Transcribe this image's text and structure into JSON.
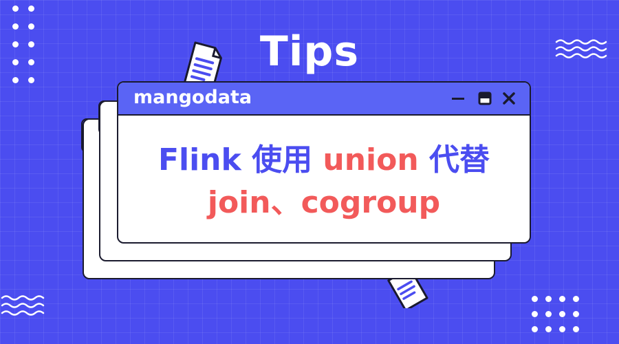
{
  "header": {
    "title": "Tips"
  },
  "window": {
    "app_name": "mangodata",
    "controls": [
      "minimize-icon",
      "maximize-icon",
      "close-icon"
    ]
  },
  "headline": {
    "line1": [
      {
        "text": "Flink 使用 ",
        "color": "#4b4df0"
      },
      {
        "text": "union",
        "color": "#f25a5a"
      },
      {
        "text": " 代替",
        "color": "#4b4df0"
      }
    ],
    "line2": "join、cogroup"
  },
  "colors": {
    "background": "#4b4df0",
    "accent_red": "#f25a5a",
    "titlebar": "#5a64f5",
    "outline": "#1a1a2e"
  }
}
